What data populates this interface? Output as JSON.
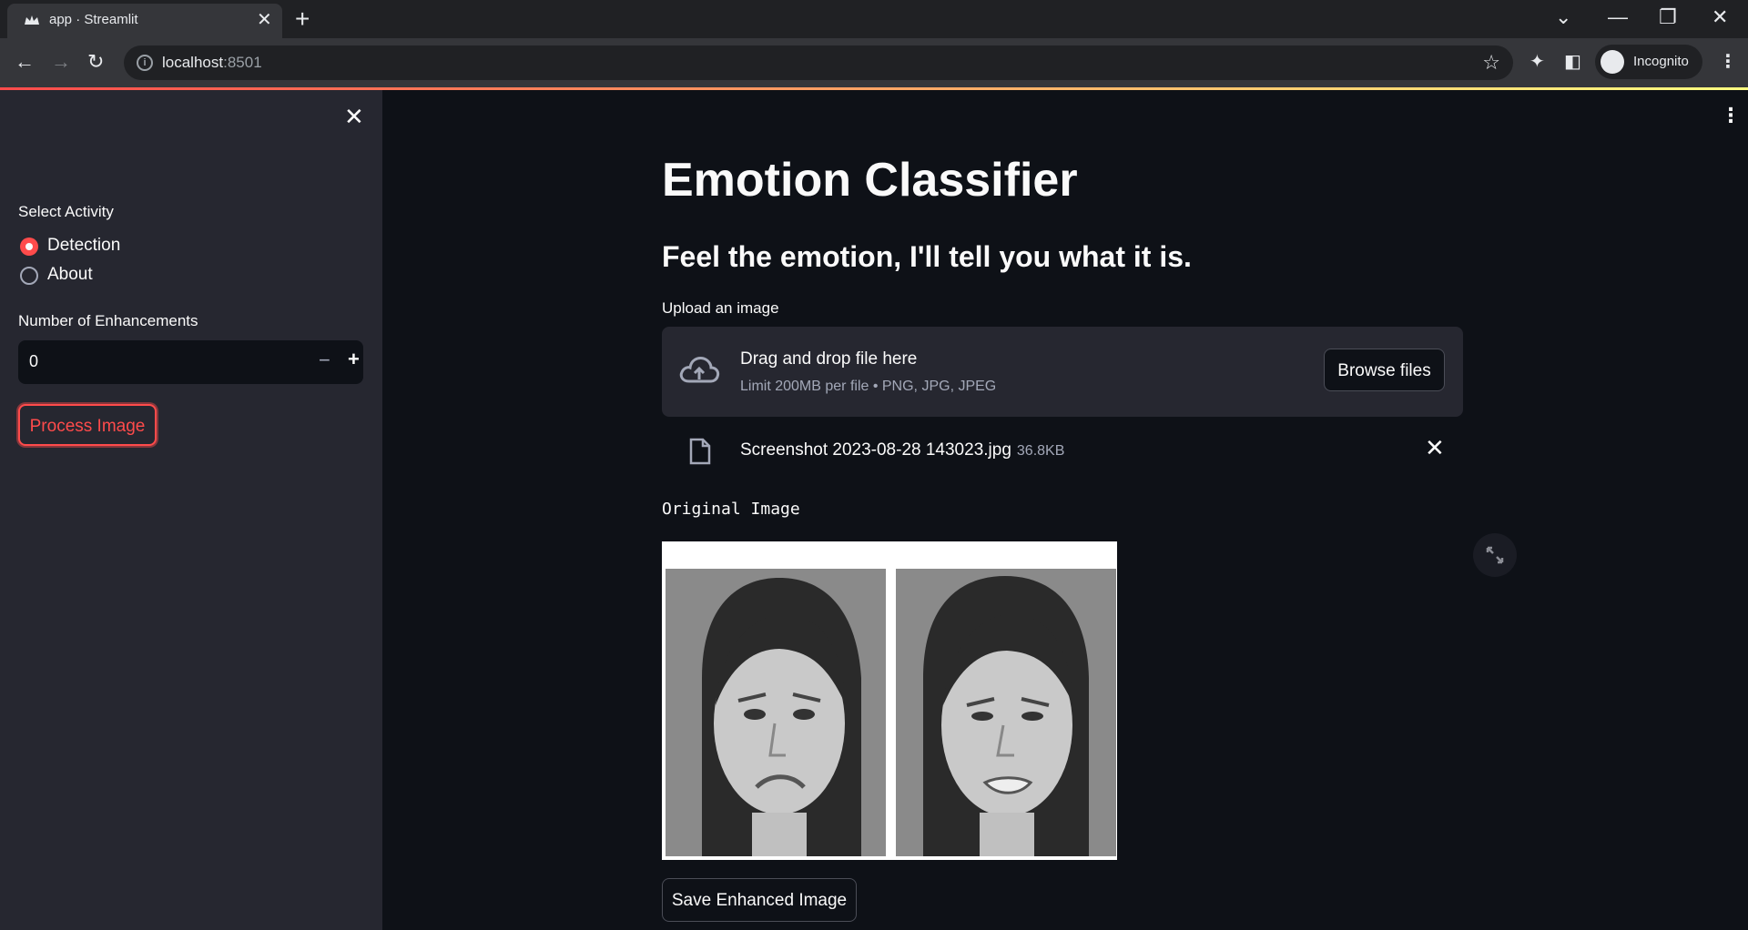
{
  "browser": {
    "tab_title": "app · Streamlit",
    "address_host": "localhost",
    "address_port": ":8501",
    "profile_label": "Incognito"
  },
  "sidebar": {
    "activity_label": "Select Activity",
    "activity_options": [
      {
        "label": "Detection",
        "selected": true
      },
      {
        "label": "About",
        "selected": false
      }
    ],
    "enhancements_label": "Number of Enhancements",
    "enhancements_value": "0",
    "process_button": "Process Image"
  },
  "main": {
    "title": "Emotion Classifier",
    "subtitle": "Feel the emotion, I'll tell you what it is.",
    "uploader": {
      "label": "Upload an image",
      "drop_text": "Drag and drop file here",
      "limit_text": "Limit 200MB per file • PNG, JPG, JPEG",
      "browse_button": "Browse files"
    },
    "uploaded_file": {
      "name": "Screenshot 2023-08-28 143023.jpg",
      "size": "36.8KB"
    },
    "original_image_label": "Original Image",
    "save_button": "Save Enhanced Image"
  },
  "colors": {
    "accent": "#ff4b4b",
    "background": "#0e1117",
    "sidebar_bg": "#262730",
    "text": "#fafafa"
  }
}
